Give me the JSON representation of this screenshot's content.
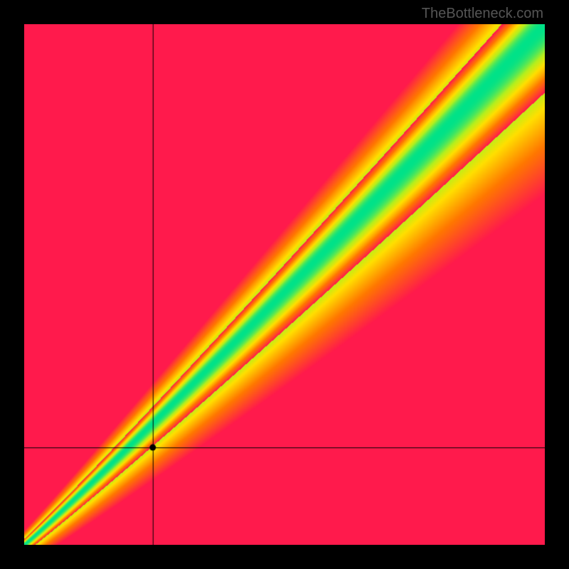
{
  "watermark": "TheBottleneck.com",
  "chart_data": {
    "type": "heatmap",
    "title": "",
    "xlabel": "",
    "ylabel": "",
    "xlim": [
      0,
      1
    ],
    "ylim": [
      0,
      1
    ],
    "crosshair": {
      "x": 0.247,
      "y": 0.187
    },
    "marker": {
      "x": 0.247,
      "y": 0.187
    },
    "optimal_curve_note": "green band along y≈x diagonal with slight curvature; bottom-left converges to a point; top pure red; right mostly green/yellow",
    "color_scale": [
      "#ff1a4c",
      "#ff6a00",
      "#ffe000",
      "#00e289"
    ],
    "grid": false,
    "legend": null
  }
}
